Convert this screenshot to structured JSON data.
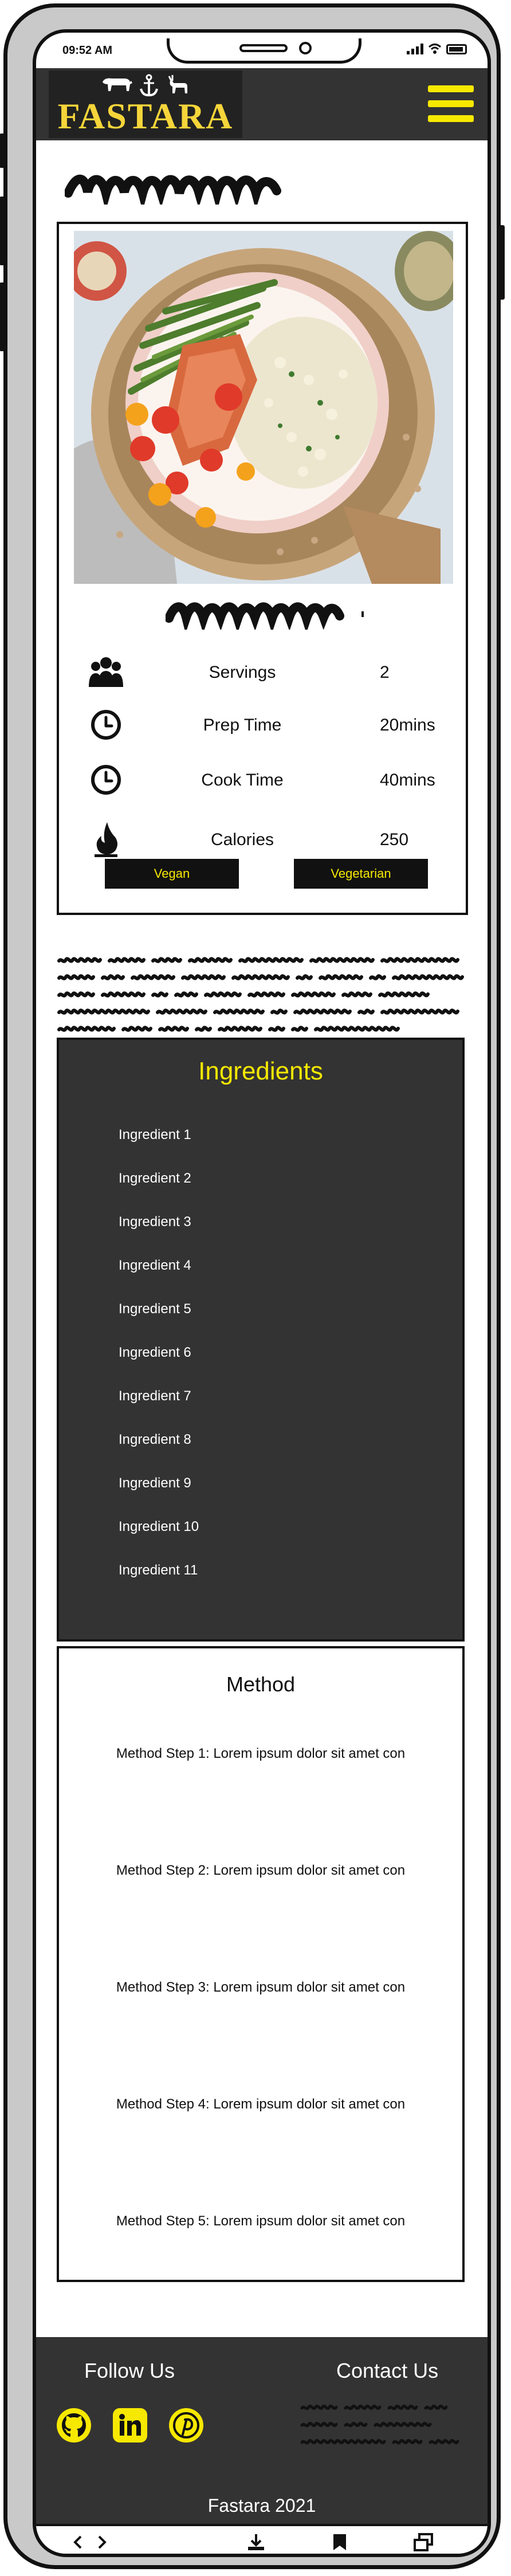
{
  "status_bar": {
    "time": "09:52 AM"
  },
  "header": {
    "logo_text": "FASTARA"
  },
  "recipe": {
    "info": [
      {
        "label": "Servings",
        "value": "2",
        "icon": "people-icon"
      },
      {
        "label": "Prep Time",
        "value": "20mins",
        "icon": "clock-icon"
      },
      {
        "label": "Cook Time",
        "value": "40mins",
        "icon": "clock-icon"
      },
      {
        "label": "Calories",
        "value": "250",
        "icon": "flame-icon"
      }
    ],
    "tags": [
      "Vegan",
      "Vegetarian"
    ]
  },
  "ingredients": {
    "title": "Ingredients",
    "items": [
      "Ingredient 1",
      "Ingredient 2",
      "Ingredient 3",
      "Ingredient 4",
      "Ingredient 5",
      "Ingredient 6",
      "Ingredient 7",
      "Ingredient 8",
      "Ingredient 9",
      "Ingredient 10",
      "Ingredient 11"
    ]
  },
  "method": {
    "title": "Method",
    "steps": [
      "Method Step 1: Lorem ipsum dolor sit amet con",
      "Method Step 2: Lorem ipsum dolor sit amet con",
      "Method Step 3: Lorem ipsum dolor sit amet con",
      "Method Step 4: Lorem ipsum dolor sit amet con",
      "Method Step 5: Lorem ipsum dolor sit amet con"
    ]
  },
  "footer": {
    "follow_us": "Follow Us",
    "contact_us": "Contact Us",
    "social": [
      "github-icon",
      "linkedin-icon",
      "pinterest-icon"
    ],
    "copyright": "Fastara 2021"
  },
  "colors": {
    "accent": "#f7e800",
    "dark": "#333333",
    "logo_gold": "#f5d53a"
  }
}
